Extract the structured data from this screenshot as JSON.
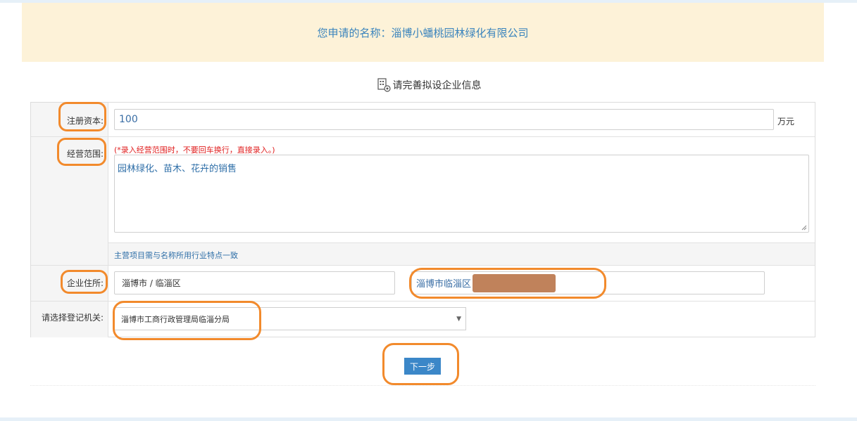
{
  "banner": {
    "text": "您申请的名称：淄博小蟠桃园林绿化有限公司"
  },
  "section": {
    "title": "请完善拟设企业信息",
    "icon": "form-document-icon"
  },
  "form": {
    "capital": {
      "label": "注册资本:",
      "value": "100",
      "unit": "万元"
    },
    "scope": {
      "label": "经营范围:",
      "warning": "(*录入经营范围时，不要回车换行，直接录入。)",
      "value": "园林绿化、苗木、花卉的销售",
      "hint": "主营项目需与名称所用行业特点一致"
    },
    "address": {
      "label": "企业住所:",
      "region": "淄博市 / 临淄区",
      "detail": "淄博市临淄区"
    },
    "authority": {
      "label": "请选择登记机关:",
      "selected": "淄博市工商行政管理局临淄分局"
    }
  },
  "actions": {
    "next_label": "下一步"
  },
  "colors": {
    "accent": "#3b87c8",
    "highlight": "#f28a2c",
    "banner_bg": "#fdf2d8",
    "warning": "#e02020"
  }
}
